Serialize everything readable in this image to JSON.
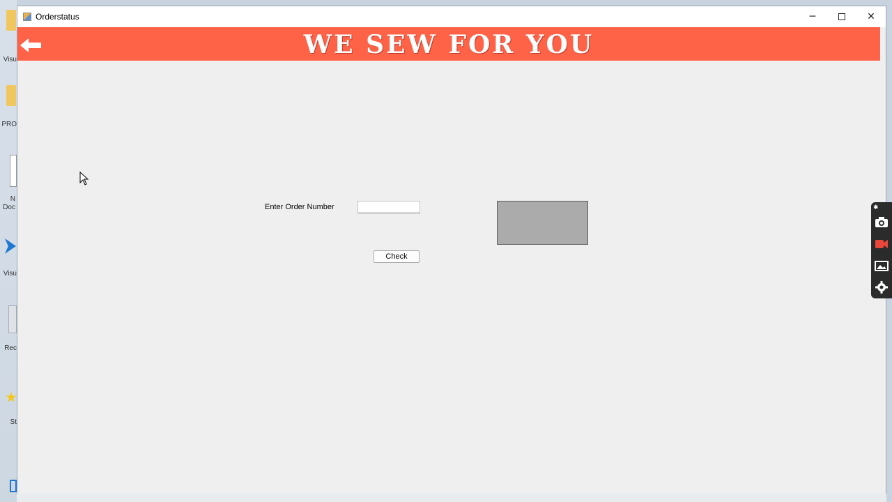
{
  "window": {
    "title": "Orderstatus",
    "controls": {
      "minimize": "─",
      "close": "✕"
    }
  },
  "banner": {
    "title": "WE SEW FOR YOU",
    "color": "#ff6347",
    "back_icon": "back-arrow-icon"
  },
  "form": {
    "order_label": "Enter Order Number",
    "order_value": "",
    "order_placeholder": "",
    "check_label": "Check"
  },
  "result_box": {
    "color": "#ababab"
  },
  "desktop": {
    "icon_labels": [
      "Visu",
      "PRO",
      "N Doc",
      "Visu",
      "Rec",
      "St"
    ]
  },
  "capture_toolbar": {
    "icons": [
      "pin-icon",
      "camera-icon",
      "video-record-icon",
      "gallery-icon",
      "settings-gear-icon"
    ]
  }
}
